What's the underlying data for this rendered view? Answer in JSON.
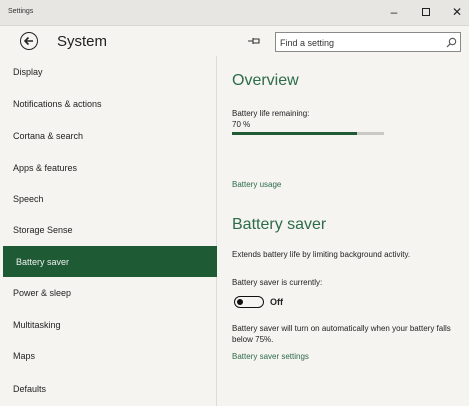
{
  "window": {
    "title": "Settings",
    "controls": {
      "minimize": "–",
      "maximize": "□",
      "close": "✕"
    }
  },
  "header": {
    "back_icon": "arrow-left-circle-icon",
    "title": "System",
    "pin_icon": "pin-icon",
    "search": {
      "placeholder": "Find a setting",
      "icon": "search-icon"
    }
  },
  "sidebar": {
    "items": [
      {
        "label": "Display",
        "active": false
      },
      {
        "label": "Notifications & actions",
        "active": false
      },
      {
        "label": "Cortana & search",
        "active": false
      },
      {
        "label": "Apps & features",
        "active": false
      },
      {
        "label": "Speech",
        "active": false
      },
      {
        "label": "Storage Sense",
        "active": false
      },
      {
        "label": "Battery saver",
        "active": true
      },
      {
        "label": "Power & sleep",
        "active": false
      },
      {
        "label": "Multitasking",
        "active": false
      },
      {
        "label": "Maps",
        "active": false
      },
      {
        "label": "Defaults",
        "active": false
      }
    ]
  },
  "main": {
    "overview": {
      "heading": "Overview",
      "remaining_label": "Battery life remaining:",
      "percent_text": "70 %",
      "progress_fraction": 0.82,
      "usage_link": "Battery usage"
    },
    "saver": {
      "heading": "Battery saver",
      "description": "Extends battery life by limiting background activity.",
      "currently_label": "Battery saver is currently:",
      "toggle_state": "Off",
      "toggle_on": false,
      "auto_text": "Battery saver will turn on automatically when your battery falls below 75%.",
      "settings_link": "Battery saver settings"
    }
  },
  "colors": {
    "accent": "#1e5b34",
    "link": "#2d6b49",
    "background": "#f5f4f1"
  }
}
